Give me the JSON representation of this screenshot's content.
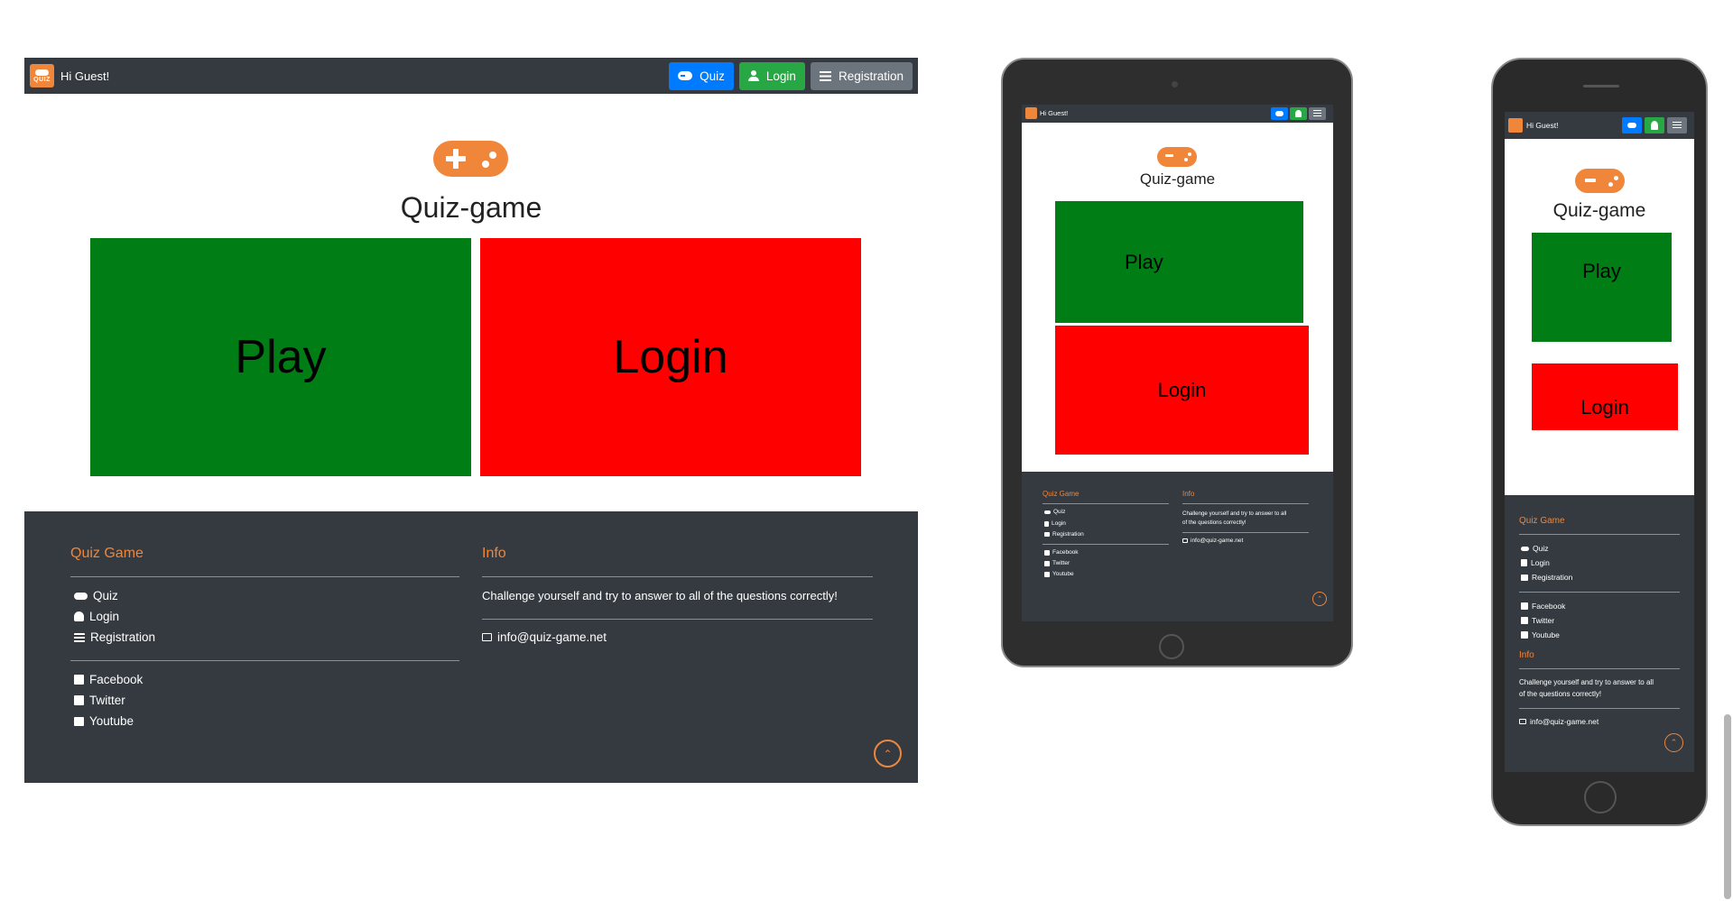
{
  "nav": {
    "greeting": "Hi Guest!",
    "logo_text": "QUIZ",
    "quiz_label": "Quiz",
    "login_label": "Login",
    "registration_label": "Registration"
  },
  "hero": {
    "title": "Quiz-game",
    "play_label": "Play",
    "login_label": "Login"
  },
  "footer": {
    "col1_title": "Quiz Game",
    "links": [
      "Quiz",
      "Login",
      "Registration"
    ],
    "social": [
      "Facebook",
      "Twitter",
      "Youtube"
    ],
    "col2_title": "Info",
    "info_text": "Challenge yourself and try to answer to all of the questions correctly!",
    "info_text_line1": "Challenge yourself and try to answer to all",
    "info_text_line2": "of the questions correctly!",
    "email": "info@quiz-game.net"
  },
  "colors": {
    "nav_bg": "#343a40",
    "accent": "#f0863a",
    "play": "#007e15",
    "login": "#ff0000",
    "btn_quiz": "#007bff",
    "btn_login": "#28a745",
    "btn_registration": "#6c757d"
  },
  "icons": {
    "logo": "gamepad-logo",
    "quiz": "gamepad-icon",
    "login": "user-icon",
    "registration": "list-icon",
    "facebook": "facebook-square-icon",
    "twitter": "twitter-square-icon",
    "youtube": "youtube-square-icon",
    "email": "envelope-icon",
    "back_to_top": "chevron-up-circle-icon"
  }
}
